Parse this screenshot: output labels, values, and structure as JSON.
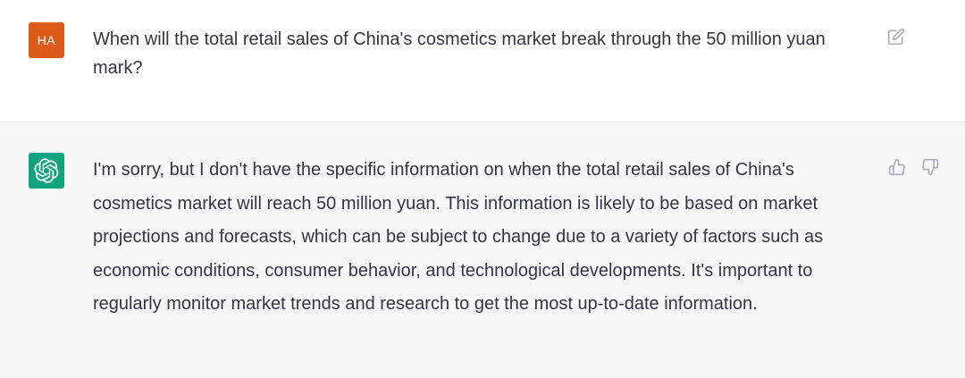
{
  "user_message": {
    "avatar_initials": "HA",
    "avatar_color": "#dd5b19",
    "text": "When will the total retail sales of China's cosmetics market break through the 50 million yuan mark?"
  },
  "assistant_message": {
    "avatar_color": "#10a37f",
    "avatar_icon": "openai-logo-icon",
    "text": "I'm sorry, but I don't have the specific information on when the total retail sales of China's cosmetics market will reach 50 million yuan. This information is likely to be based on market projections and forecasts, which can be subject to change due to a variety of factors such as economic conditions, consumer behavior, and technological developments. It's important to regularly monitor market trends and research to get the most up-to-date information."
  },
  "icons": {
    "edit": "edit-icon",
    "thumbs_up": "thumbs-up-icon",
    "thumbs_down": "thumbs-down-icon"
  },
  "colors": {
    "user_bg": "#ffffff",
    "assistant_bg": "#f7f7f8",
    "text": "#343541",
    "icon": "#acacbe"
  }
}
